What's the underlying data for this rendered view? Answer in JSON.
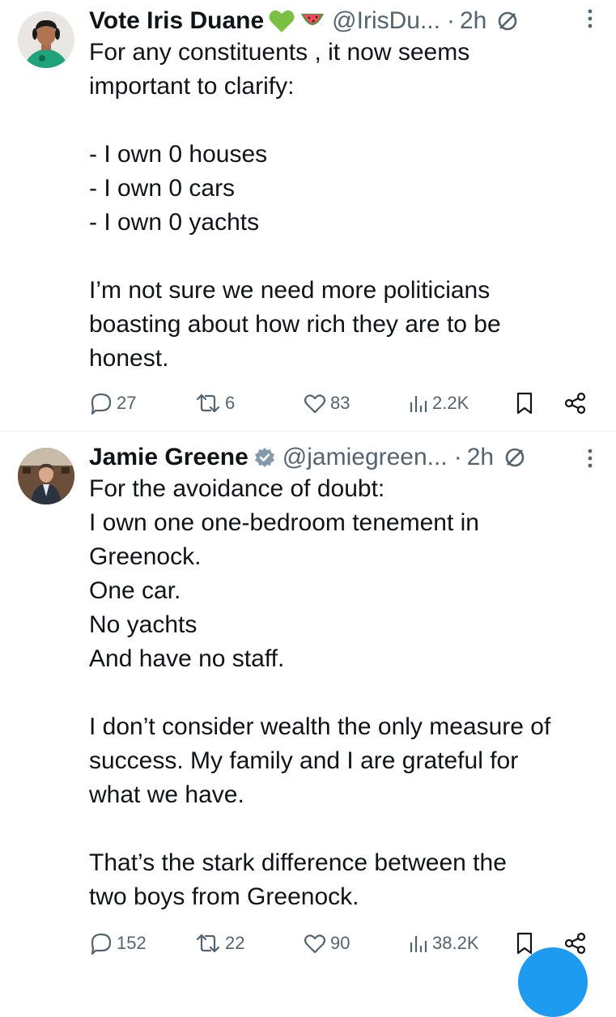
{
  "tweets": [
    {
      "name": "Vote Iris Duane",
      "emojis": [
        "green-heart",
        "watermelon"
      ],
      "handle": "@IrisDu...",
      "dot": "·",
      "time": "2h",
      "verified": false,
      "text": "For any constituents , it now seems\nimportant to clarify:\n\n- I own 0 houses\n- I own 0 cars\n- I own 0 yachts\n\nI’m not sure we need more politicians\nboasting about how rich they are to be\nhonest.",
      "stats": {
        "replies": "27",
        "reposts": "6",
        "likes": "83",
        "views": "2.2K"
      }
    },
    {
      "name": "Jamie Greene",
      "emojis": [],
      "handle": "@jamiegreen...",
      "dot": "·",
      "time": "2h",
      "verified": true,
      "text": "For the avoidance of doubt:\nI own one one-bedroom tenement in\nGreenock.\nOne car.\nNo yachts\nAnd have no staff.\n\nI don’t consider wealth the only measure of\nsuccess. My family and I are grateful for\nwhat we have.\n\nThat’s the stark difference between the\ntwo boys from Greenock.",
      "stats": {
        "replies": "152",
        "reposts": "22",
        "likes": "90",
        "views": "38.2K"
      }
    }
  ],
  "icons": {
    "reply": "reply-icon",
    "repost": "repost-icon",
    "like": "heart-icon",
    "views": "views-icon",
    "bookmark": "bookmark-icon",
    "share": "share-icon",
    "more": "more-vertical-icon",
    "no_entry": "no-entry-icon",
    "verified": "verified-badge-icon",
    "compose": "compose-fab"
  },
  "colors": {
    "text": "#0f1419",
    "secondary": "#536471",
    "accent": "#1d9bf0",
    "heart_emoji": "#7ac143",
    "divider": "#eff3f4"
  }
}
